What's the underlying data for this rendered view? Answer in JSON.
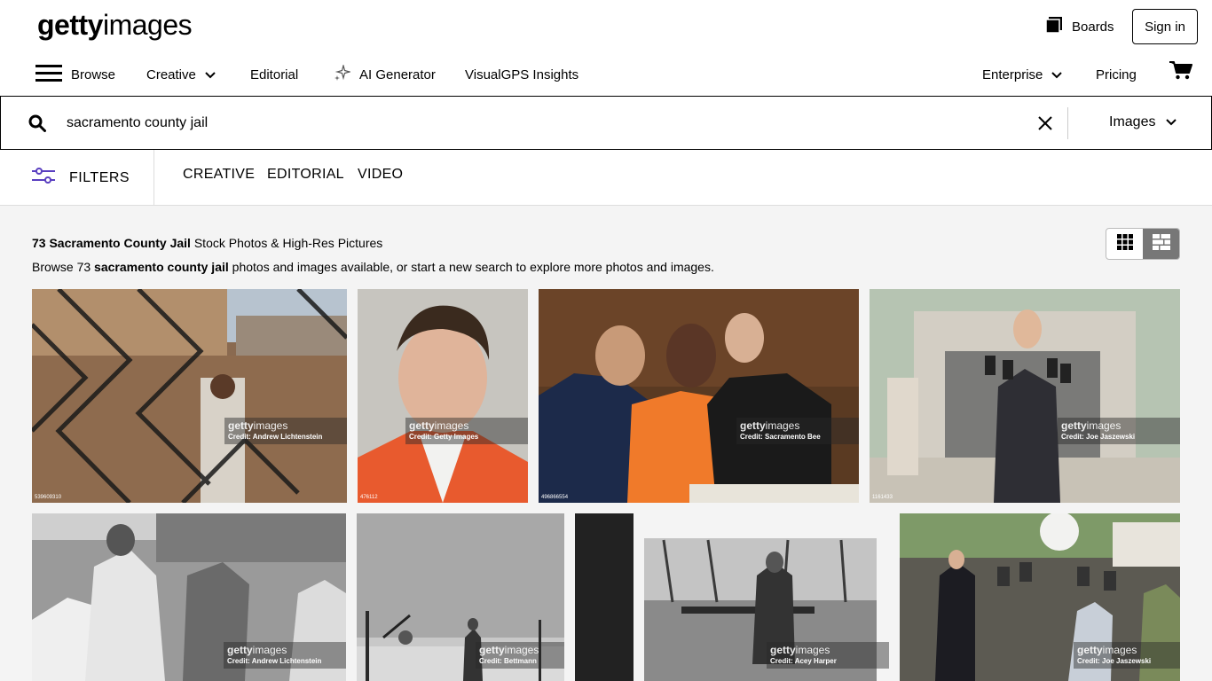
{
  "logo": {
    "bold": "getty",
    "light": "images"
  },
  "header": {
    "boards_label": "Boards",
    "signin_label": "Sign in"
  },
  "nav": {
    "browse": "Browse",
    "creative": "Creative",
    "editorial": "Editorial",
    "ai_generator": "AI Generator",
    "visualgps": "VisualGPS Insights",
    "enterprise": "Enterprise",
    "pricing": "Pricing"
  },
  "search": {
    "query": "sacramento county jail",
    "type": "Images"
  },
  "filters": {
    "label": "FILTERS",
    "tabs": [
      "CREATIVE",
      "EDITORIAL",
      "VIDEO"
    ]
  },
  "results": {
    "title_bold": "73 Sacramento County Jail",
    "title_rest": " Stock Photos & High-Res Pictures",
    "sub_pre": "Browse 73 ",
    "sub_bold": "sacramento county jail",
    "sub_post": " photos and images available, or start a new search to explore more photos and images."
  },
  "images": [
    {
      "credit": "Credit: Andrew Lichtenstein",
      "id": "539609310"
    },
    {
      "credit": "Credit: Getty Images",
      "id": "476112"
    },
    {
      "credit": "Credit: Sacramento Bee",
      "id": "496866554"
    },
    {
      "credit": "Credit: Joe Jaszewski",
      "id": "1161433"
    },
    {
      "credit": "Credit: Andrew Lichtenstein",
      "id": ""
    },
    {
      "credit": "Credit: Bettmann",
      "id": ""
    },
    {
      "credit": "Credit: Acey Harper",
      "id": ""
    },
    {
      "credit": "Credit: Joe Jaszewski",
      "id": ""
    }
  ],
  "watermark": {
    "bold": "getty",
    "light": "images"
  },
  "colors": {
    "accent": "#5a3fc0",
    "border": "#000000",
    "page_bg": "#f4f4f4"
  }
}
